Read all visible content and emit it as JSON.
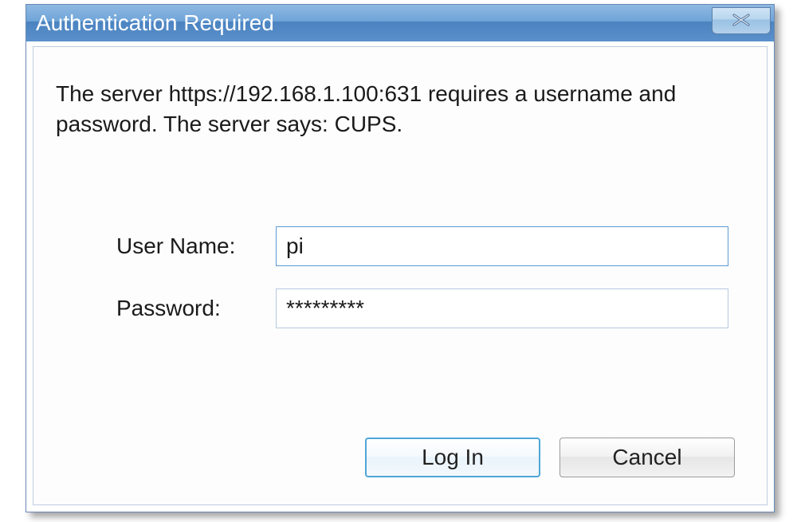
{
  "dialog": {
    "title": "Authentication Required",
    "message": "The server https://192.168.1.100:631 requires a username and password. The server says: CUPS.",
    "username": {
      "label": "User Name:",
      "value": "pi"
    },
    "password": {
      "label": "Password:",
      "value": "*********"
    },
    "buttons": {
      "login": "Log In",
      "cancel": "Cancel"
    }
  }
}
